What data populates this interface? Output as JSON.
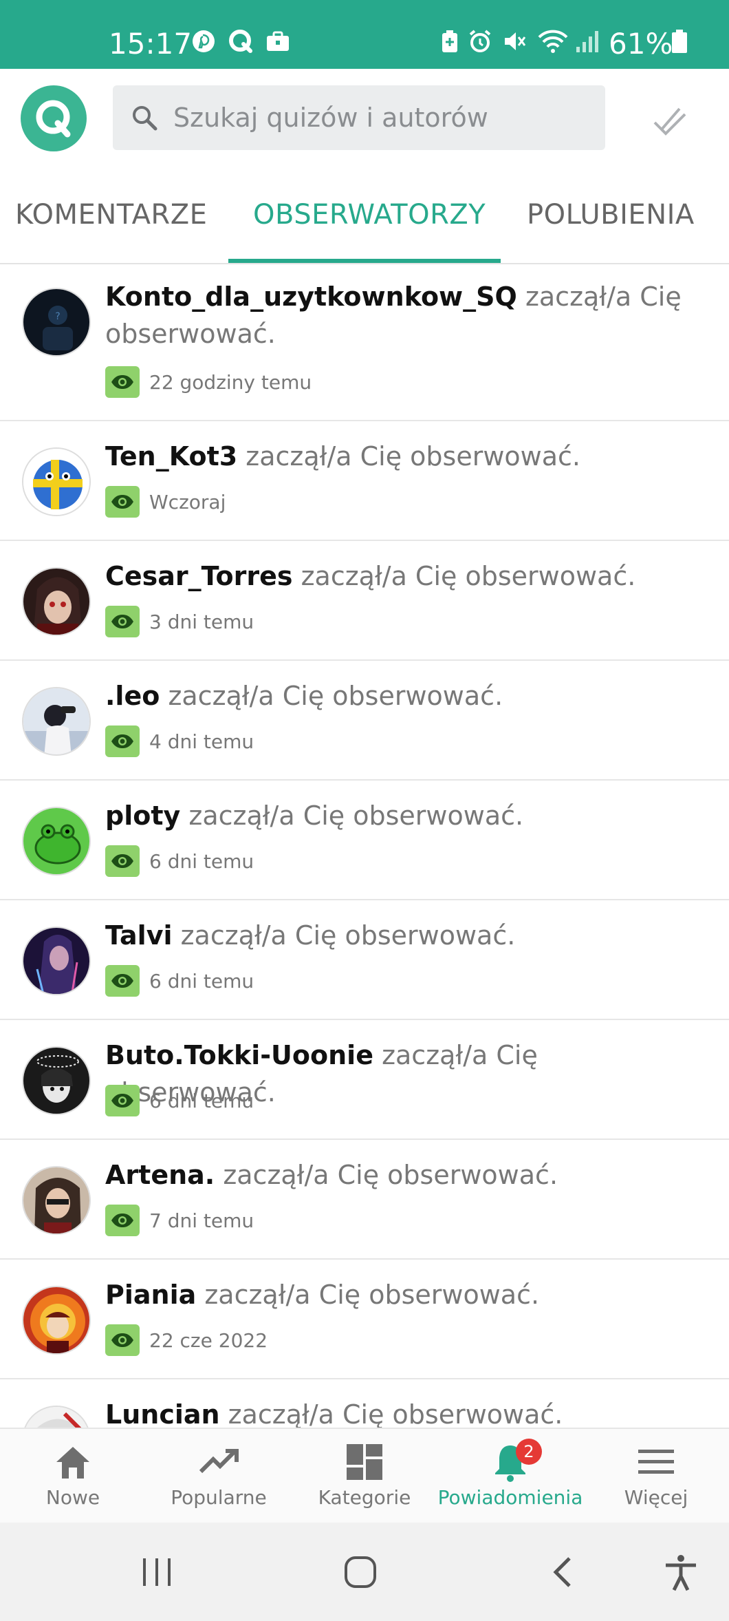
{
  "status_bar": {
    "time": "15:17",
    "battery": "61%",
    "icons": [
      "pinterest-icon",
      "quizapp-icon",
      "briefcase-icon",
      "battery-saver-icon",
      "alarm-icon",
      "mute-icon",
      "wifi-icon",
      "signal-icon",
      "battery-icon"
    ]
  },
  "header": {
    "logo_letter": "Q",
    "search_placeholder": "Szukaj quizów i autorów"
  },
  "tabs": [
    {
      "label": "KOMENTARZE",
      "active": false
    },
    {
      "label": "OBSERWATORZY",
      "active": true
    },
    {
      "label": "POLUBIENIA",
      "active": false
    }
  ],
  "notifications": [
    {
      "username": "Konto_dla_uzytkownkow_SQ",
      "action": "zaczął/a Cię obserwować.",
      "time": "22 godziny temu"
    },
    {
      "username": "Ten_Kot3",
      "action": "zaczął/a Cię obserwować.",
      "time": "Wczoraj"
    },
    {
      "username": "Cesar_Torres",
      "action": "zaczął/a Cię obserwować.",
      "time": "3 dni temu"
    },
    {
      "username": ".leo",
      "action": "zaczął/a Cię obserwować.",
      "time": "4 dni temu"
    },
    {
      "username": "ploty",
      "action": "zaczął/a Cię obserwować.",
      "time": "6 dni temu"
    },
    {
      "username": "Talvi",
      "action": "zaczął/a Cię obserwować.",
      "time": "6 dni temu"
    },
    {
      "username": "Buto.Tokki-Uoonie",
      "action": "zaczął/a Cię obserwować.",
      "time": "6 dni temu"
    },
    {
      "username": "Artena.",
      "action": "zaczął/a Cię obserwować.",
      "time": "7 dni temu"
    },
    {
      "username": "Piania",
      "action": "zaczął/a Cię obserwować.",
      "time": "22 cze 2022"
    },
    {
      "username": "Luncian",
      "action": "zaczął/a Cię obserwować.",
      "time": ""
    }
  ],
  "bottom_nav": [
    {
      "label": "Nowe",
      "icon": "home-icon",
      "active": false
    },
    {
      "label": "Popularne",
      "icon": "trending-icon",
      "active": false
    },
    {
      "label": "Kategorie",
      "icon": "dashboard-icon",
      "active": false
    },
    {
      "label": "Powiadomienia",
      "icon": "bell-icon",
      "active": true,
      "badge": "2"
    },
    {
      "label": "Więcej",
      "icon": "menu-icon",
      "active": false
    }
  ],
  "colors": {
    "accent": "#27a98c",
    "badge_green": "#8fd16b",
    "notification_red": "#e53935"
  }
}
